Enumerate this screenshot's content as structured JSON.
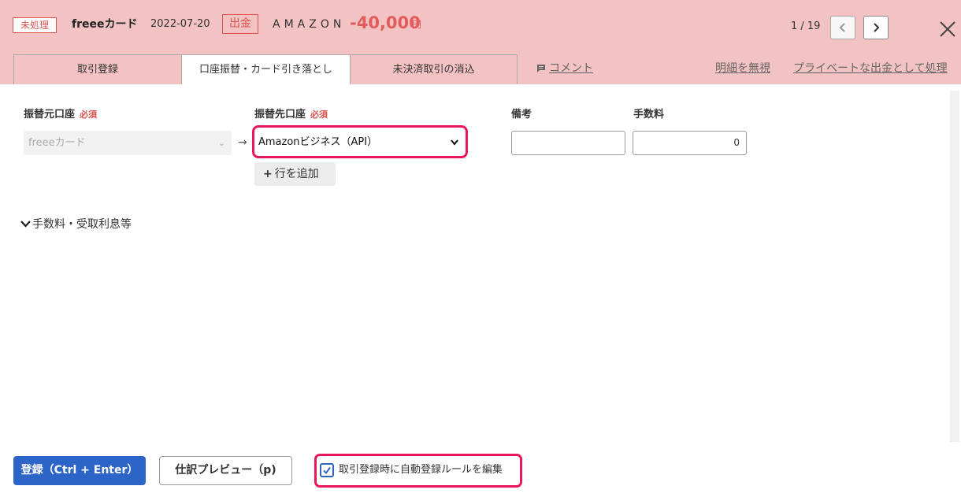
{
  "header": {
    "status_badge": "未処理",
    "account_name": "freeeカード",
    "date": "2022-07-20",
    "direction": "出金",
    "merchant": "AMAZON",
    "amount": "-40,000",
    "currency": "円",
    "page_counter": "1 / 19",
    "prev_icon": "chevron-left-icon",
    "next_icon": "chevron-right-icon",
    "close_icon": "close-icon"
  },
  "tabs": [
    {
      "label": "取引登録",
      "active": false
    },
    {
      "label": "口座振替・カード引き落とし",
      "active": true
    },
    {
      "label": "未決済取引の消込",
      "active": false
    }
  ],
  "header_links": {
    "comment": "コメント",
    "ignore": "明細を無視",
    "private": "プライベートな出金として処理"
  },
  "form": {
    "source_label": "振替元口座",
    "dest_label": "振替先口座",
    "required": "必須",
    "memo_label": "備考",
    "fee_label": "手数料",
    "source_value": "freeeカード",
    "dest_value": "Amazonビジネス（API）",
    "memo_value": "",
    "fee_value": "0",
    "add_row": "行を追加",
    "fee_section_toggle": "手数料・受取利息等"
  },
  "footer": {
    "register": "登録（Ctrl + Enter）",
    "preview": "仕訳プレビュー（p)",
    "auto_rule_checked": true,
    "auto_rule_label": "取引登録時に自動登録ルールを編集"
  },
  "colors": {
    "header_bg": "#f3c2c3",
    "alert_red": "#d9534f",
    "amount_red": "#e35b5b",
    "highlight": "#e8175d",
    "primary_blue": "#2d64c8"
  }
}
